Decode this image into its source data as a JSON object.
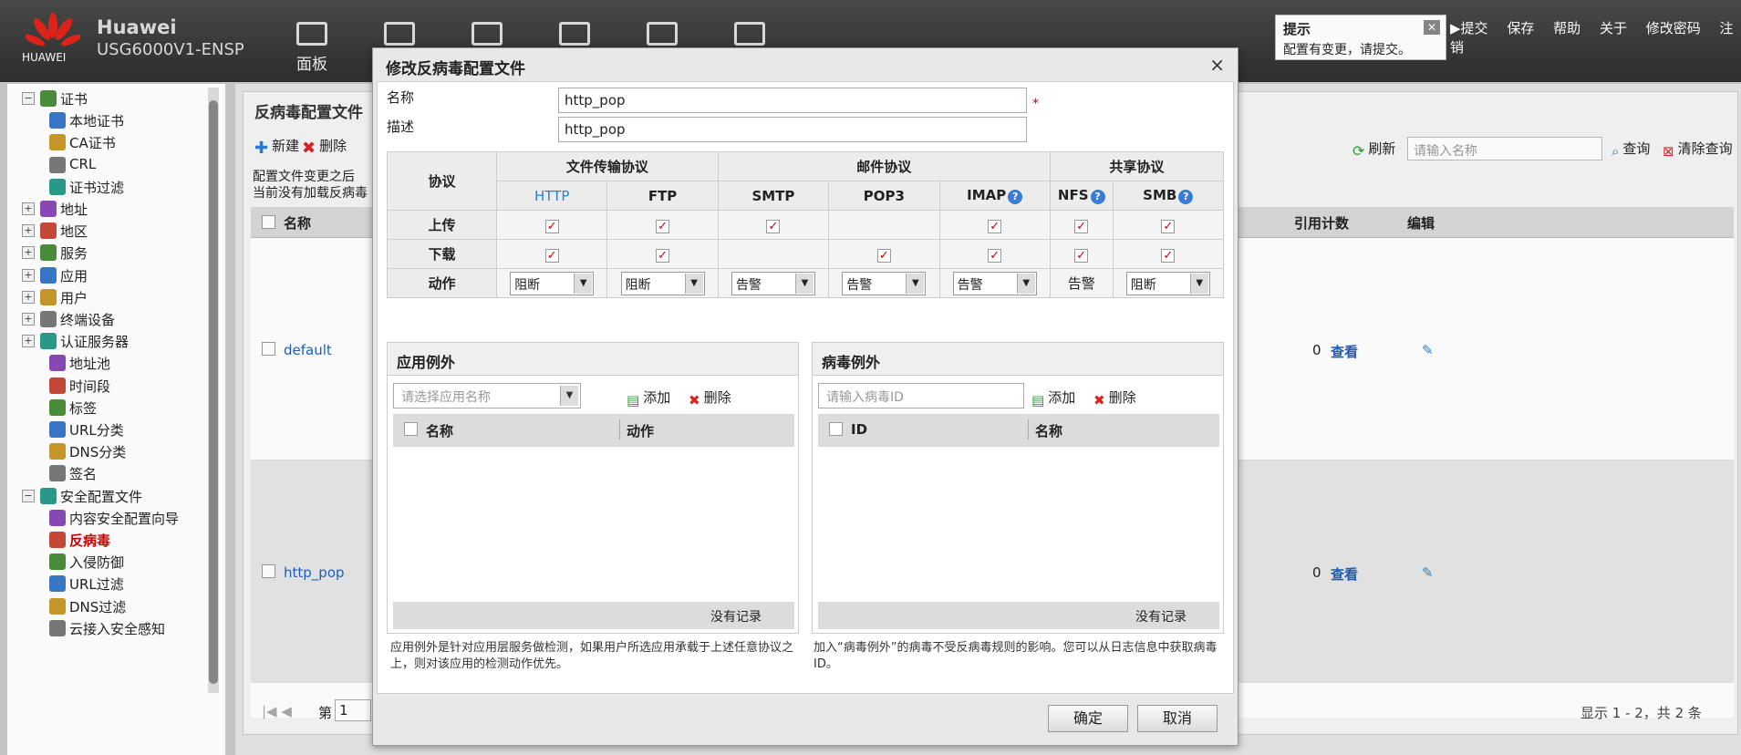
{
  "header": {
    "brand": "Huawei",
    "model": "USG6000V1-ENSP",
    "logo_text": "HUAWEI",
    "nav_label": "面板"
  },
  "notice": {
    "title": "提示",
    "message": "配置有变更，请提交。"
  },
  "top_links": [
    "提交",
    "保存",
    "帮助",
    "关于",
    "修改密码",
    "注销"
  ],
  "sidebar": {
    "items": [
      {
        "label": "证书",
        "level": 0,
        "expanded": true
      },
      {
        "label": "本地证书",
        "level": 1
      },
      {
        "label": "CA证书",
        "level": 1
      },
      {
        "label": "CRL",
        "level": 1
      },
      {
        "label": "证书过滤",
        "level": 1
      },
      {
        "label": "地址",
        "level": 0
      },
      {
        "label": "地区",
        "level": 0
      },
      {
        "label": "服务",
        "level": 0
      },
      {
        "label": "应用",
        "level": 0
      },
      {
        "label": "用户",
        "level": 0
      },
      {
        "label": "终端设备",
        "level": 0
      },
      {
        "label": "认证服务器",
        "level": 0
      },
      {
        "label": "地址池",
        "level": 1
      },
      {
        "label": "时间段",
        "level": 1
      },
      {
        "label": "标签",
        "level": 1
      },
      {
        "label": "URL分类",
        "level": 1
      },
      {
        "label": "DNS分类",
        "level": 1
      },
      {
        "label": "签名",
        "level": 1
      },
      {
        "label": "安全配置文件",
        "level": 0,
        "expanded": true
      },
      {
        "label": "内容安全配置向导",
        "level": 1
      },
      {
        "label": "反病毒",
        "level": 1,
        "active": true
      },
      {
        "label": "入侵防御",
        "level": 1
      },
      {
        "label": "URL过滤",
        "level": 1
      },
      {
        "label": "DNS过滤",
        "level": 1
      },
      {
        "label": "云接入安全感知",
        "level": 1
      }
    ]
  },
  "main": {
    "title": "反病毒配置文件",
    "toolbar": {
      "new": "新建",
      "delete": "删除",
      "refresh": "刷新",
      "search_placeholder": "请输入名称",
      "query": "查询",
      "clear_query": "清除查询"
    },
    "info1": "配置文件变更之后",
    "info2": "当前没有加载反病毒",
    "columns": {
      "name": "名称",
      "ref_count": "引用计数",
      "edit": "编辑"
    },
    "rows": [
      {
        "name": "default",
        "ref_count": "0",
        "view": "查看"
      },
      {
        "name": "http_pop",
        "ref_count": "0",
        "view": "查看"
      }
    ],
    "pager": {
      "page_label": "第",
      "page": "1",
      "summary": "显示 1 - 2，共 2 条"
    }
  },
  "dialog": {
    "title": "修改反病毒配置文件",
    "name_label": "名称",
    "name_value": "http_pop",
    "required_mark": "*",
    "desc_label": "描述",
    "desc_value": "http_pop",
    "proto_table": {
      "protocol": "协议",
      "upload": "上传",
      "download": "下载",
      "action": "动作",
      "groups": [
        "文件传输协议",
        "邮件协议",
        "共享协议"
      ],
      "protocols": [
        "HTTP",
        "FTP",
        "SMTP",
        "POP3",
        "IMAP",
        "NFS",
        "SMB"
      ],
      "upload_checked": [
        true,
        true,
        true,
        false,
        true,
        true,
        true
      ],
      "download_checked": [
        true,
        true,
        false,
        true,
        true,
        true,
        true
      ],
      "actions": [
        "阻断",
        "阻断",
        "告警",
        "告警",
        "告警",
        "告警",
        "阻断"
      ],
      "help": "?"
    },
    "app_exception": {
      "title": "应用例外",
      "placeholder": "请选择应用名称",
      "add": "添加",
      "delete": "删除",
      "col1": "名称",
      "col2": "动作",
      "empty": "没有记录",
      "note": "应用例外是针对应用层服务做检测，如果用户所选应用承载于上述任意协议之上，则对该应用的检测动作优先。"
    },
    "virus_exception": {
      "title": "病毒例外",
      "placeholder": "请输入病毒ID",
      "add": "添加",
      "delete": "删除",
      "col1": "ID",
      "col2": "名称",
      "empty": "没有记录",
      "note": "加入“病毒例外”的病毒不受反病毒规则的影响。您可以从日志信息中获取病毒ID。"
    },
    "ok": "确定",
    "cancel": "取消"
  }
}
